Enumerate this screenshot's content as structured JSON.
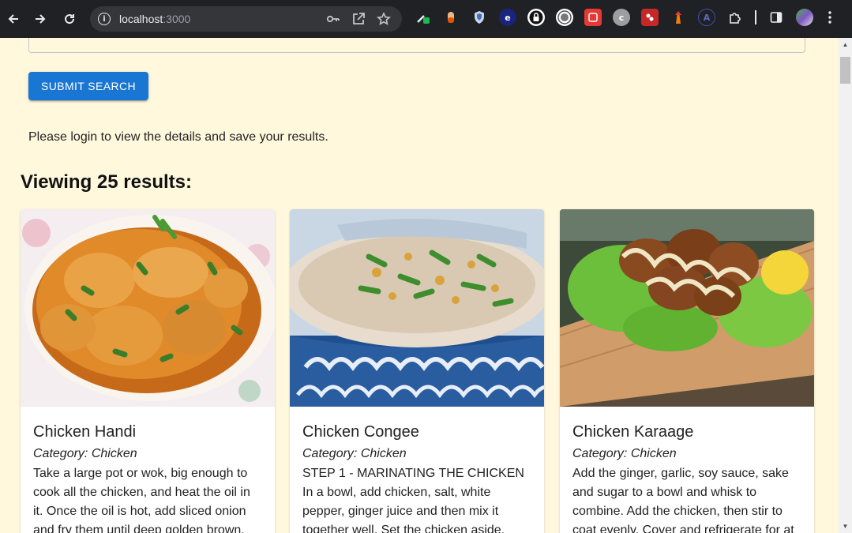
{
  "browser": {
    "url_host": "localhost",
    "url_port": ":3000"
  },
  "page": {
    "submit_label": "SUBMIT SEARCH",
    "login_message": "Please login to view the details and save your results.",
    "results_heading": "Viewing 25 results:"
  },
  "cards": [
    {
      "title": "Chicken Handi",
      "category": "Category: Chicken",
      "description": "Take a large pot or wok, big enough to cook all the chicken, and heat the oil in it. Once the oil is hot, add sliced onion and fry them until deep golden brown."
    },
    {
      "title": "Chicken Congee",
      "category": "Category: Chicken",
      "description": "STEP 1 - MARINATING THE CHICKEN In a bowl, add chicken, salt, white pepper, ginger juice and then mix it together well. Set the chicken aside."
    },
    {
      "title": "Chicken Karaage",
      "category": "Category: Chicken",
      "description": "Add the ginger, garlic, soy sauce, sake and sugar to a bowl and whisk to combine. Add the chicken, then stir to coat evenly. Cover and refrigerate for at"
    }
  ],
  "colors": {
    "page_bg": "#fff8dd",
    "primary": "#1976d2",
    "chrome_bg": "#202124"
  }
}
